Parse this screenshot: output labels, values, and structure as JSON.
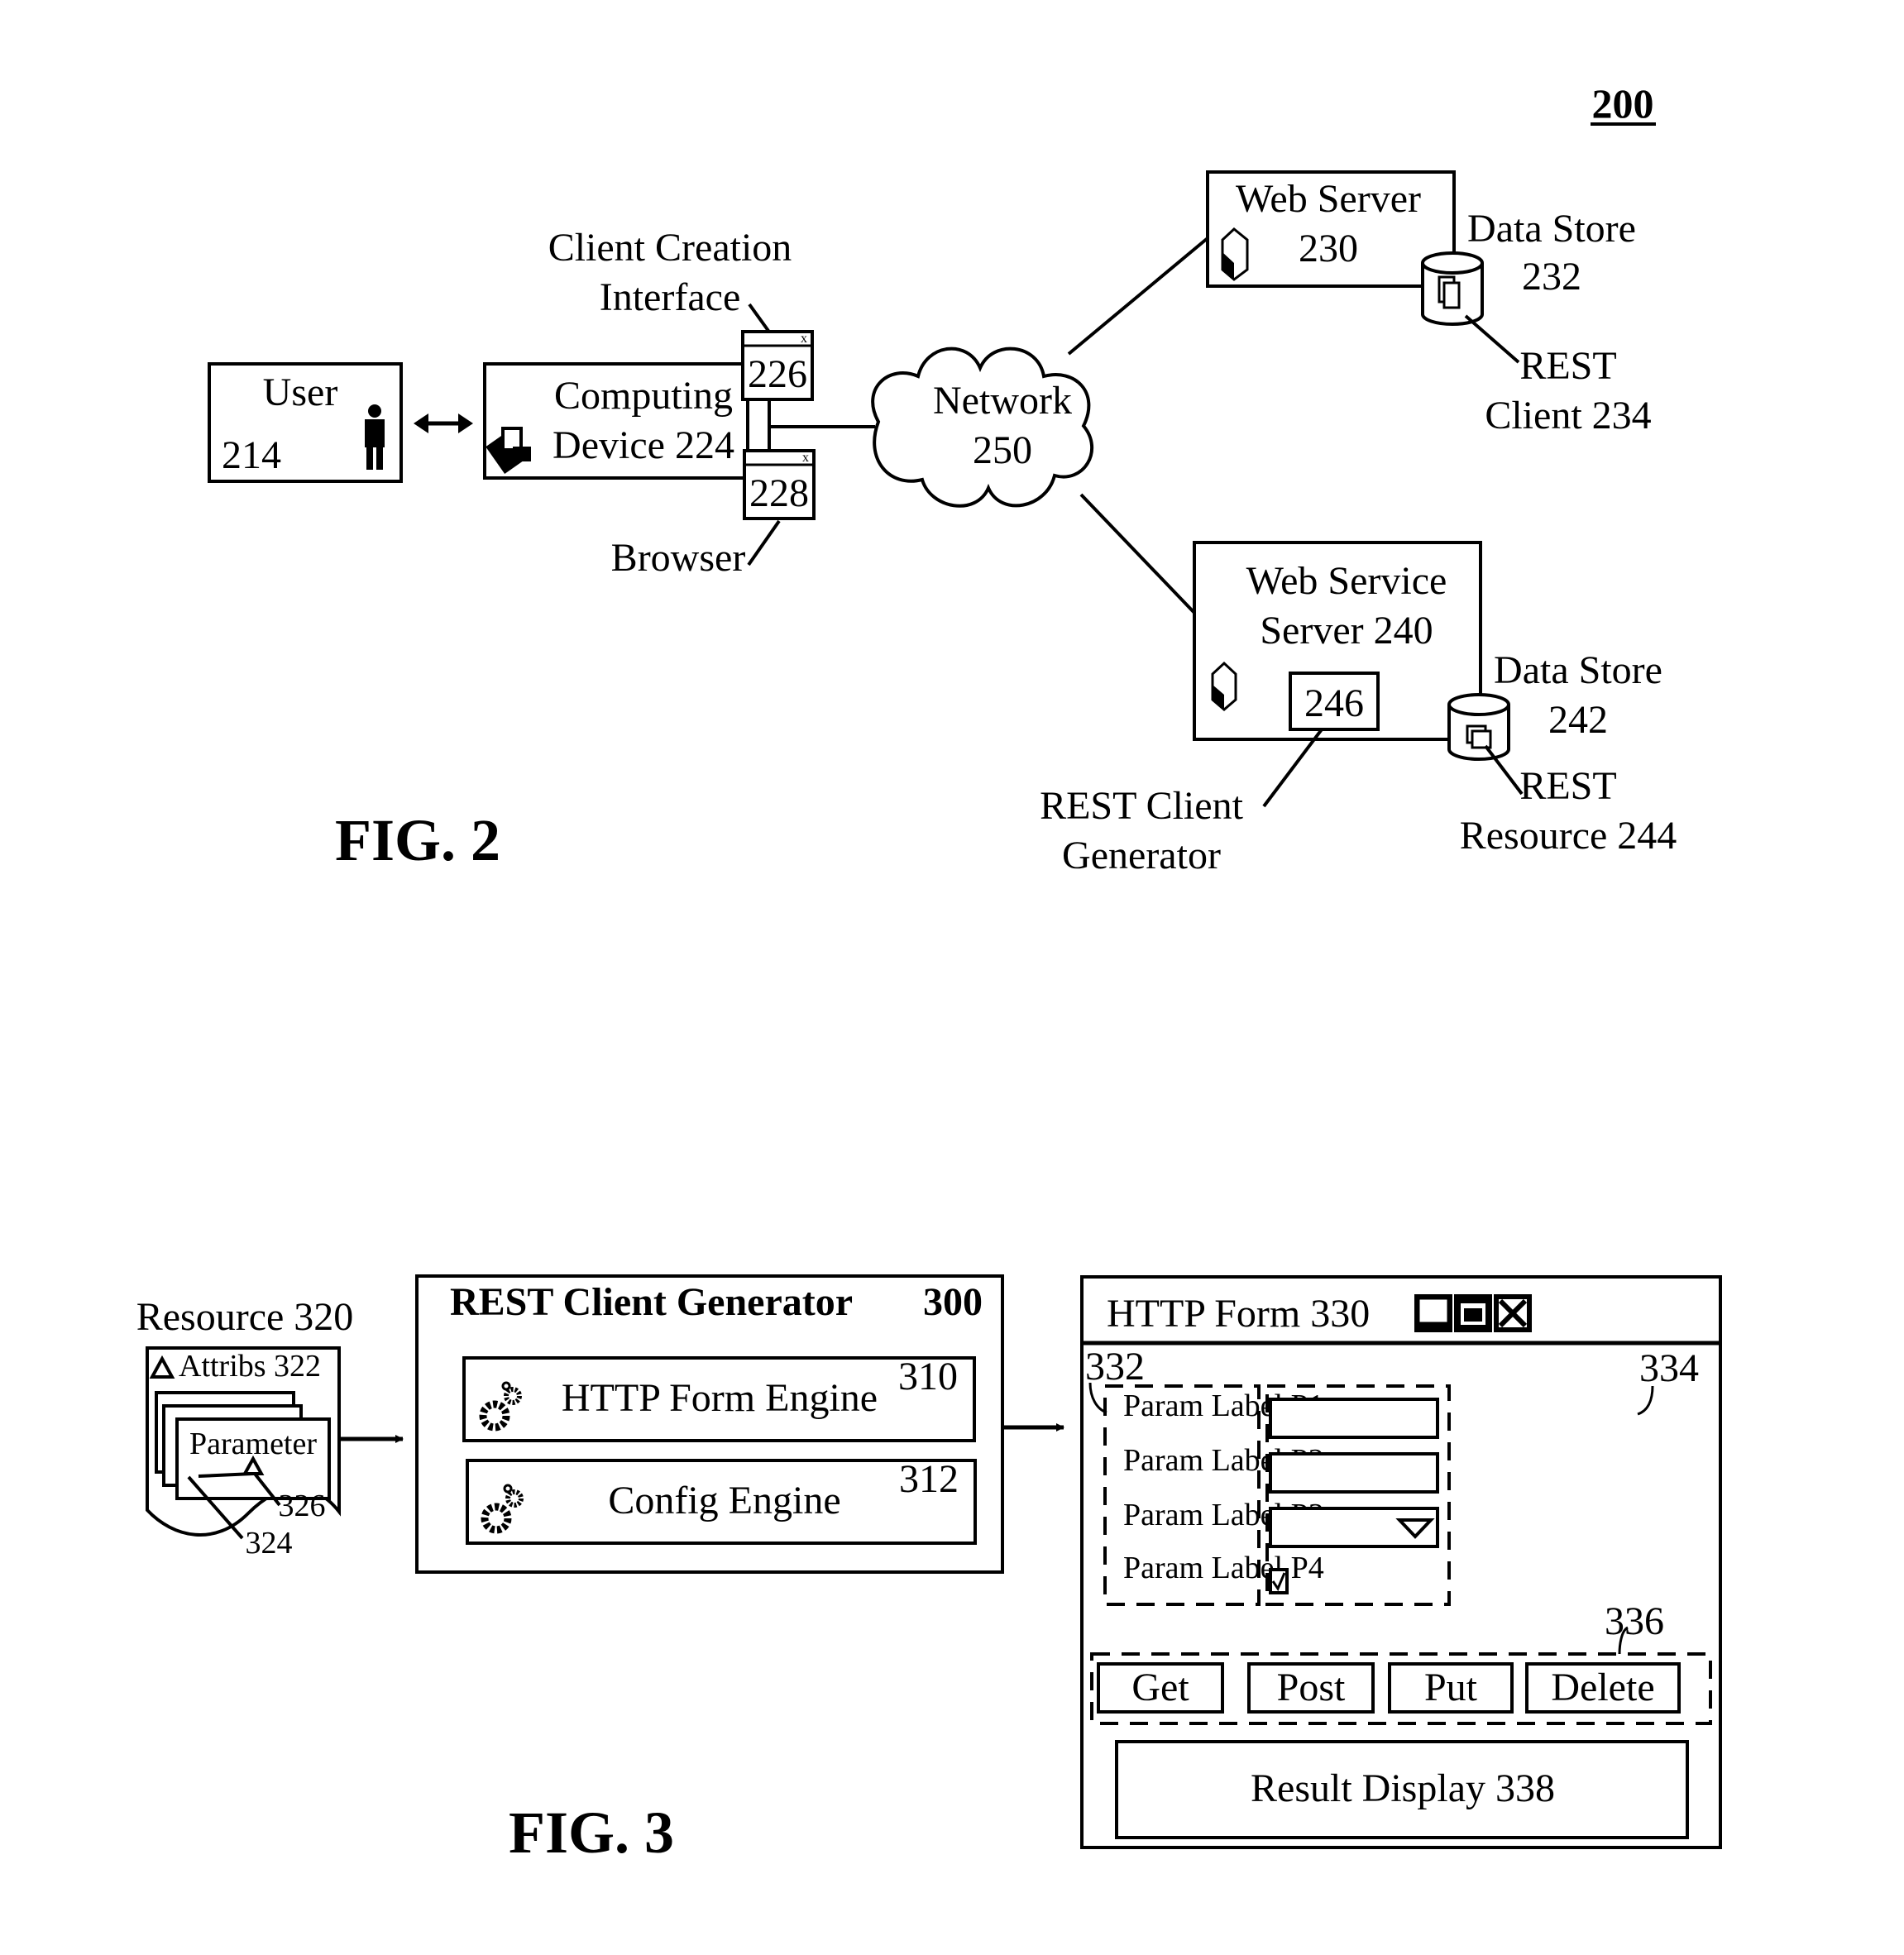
{
  "sheet_ref": "200",
  "fig2": {
    "caption": "FIG. 2",
    "user": {
      "label": "User",
      "ref": "214",
      "icon": "person-icon"
    },
    "computing_device": {
      "line1": "Computing",
      "line2": "Device 224",
      "icon": "computer-icon"
    },
    "client_creation_interface": {
      "line1": "Client Creation",
      "line2": "Interface",
      "ref": "226",
      "close_glyph": "x"
    },
    "browser": {
      "label": "Browser",
      "ref": "228",
      "close_glyph": "x"
    },
    "network": {
      "line1": "Network",
      "line2": "250"
    },
    "web_server": {
      "line1": "Web Server",
      "line2": "230",
      "icon": "server-icon"
    },
    "data_store_232": {
      "line1": "Data Store",
      "line2": "232",
      "icon": "database-icon"
    },
    "rest_client_234": {
      "line1": "REST",
      "line2": "Client 234"
    },
    "web_service_server": {
      "line1": "Web Service",
      "line2": "Server 240",
      "icon": "server-icon",
      "inner_ref": "246"
    },
    "data_store_242": {
      "line1": "Data Store",
      "line2": "242",
      "icon": "database-icon"
    },
    "rest_resource_244": {
      "line1": "REST",
      "line2": "Resource 244"
    },
    "rest_client_generator": {
      "line1": "REST Client",
      "line2": "Generator"
    }
  },
  "fig3": {
    "caption": "FIG. 3",
    "resource": {
      "title": "Resource 320",
      "attribs": "Attribs 322",
      "parameter": "Parameter",
      "ref_324": "324",
      "ref_326": "326"
    },
    "generator": {
      "title": "REST Client Generator",
      "ref": "300",
      "engines": [
        {
          "label": "HTTP Form Engine",
          "ref": "310",
          "icon": "gears-icon"
        },
        {
          "label": "Config Engine",
          "ref": "312",
          "icon": "gears-icon"
        }
      ]
    },
    "http_form": {
      "title": "HTTP Form 330",
      "window_controls": [
        "minimize",
        "maximize",
        "close"
      ],
      "labels_ref": "332",
      "inputs_ref": "334",
      "buttons_ref": "336",
      "params": [
        {
          "label": "Param Label P1",
          "control": "text"
        },
        {
          "label": "Param Label P2",
          "control": "text"
        },
        {
          "label": "Param Label P3",
          "control": "dropdown"
        },
        {
          "label": "Param Label P4",
          "control": "checkbox",
          "checked": true
        }
      ],
      "buttons": [
        "Get",
        "Post",
        "Put",
        "Delete"
      ],
      "result_display": "Result Display 338"
    }
  }
}
